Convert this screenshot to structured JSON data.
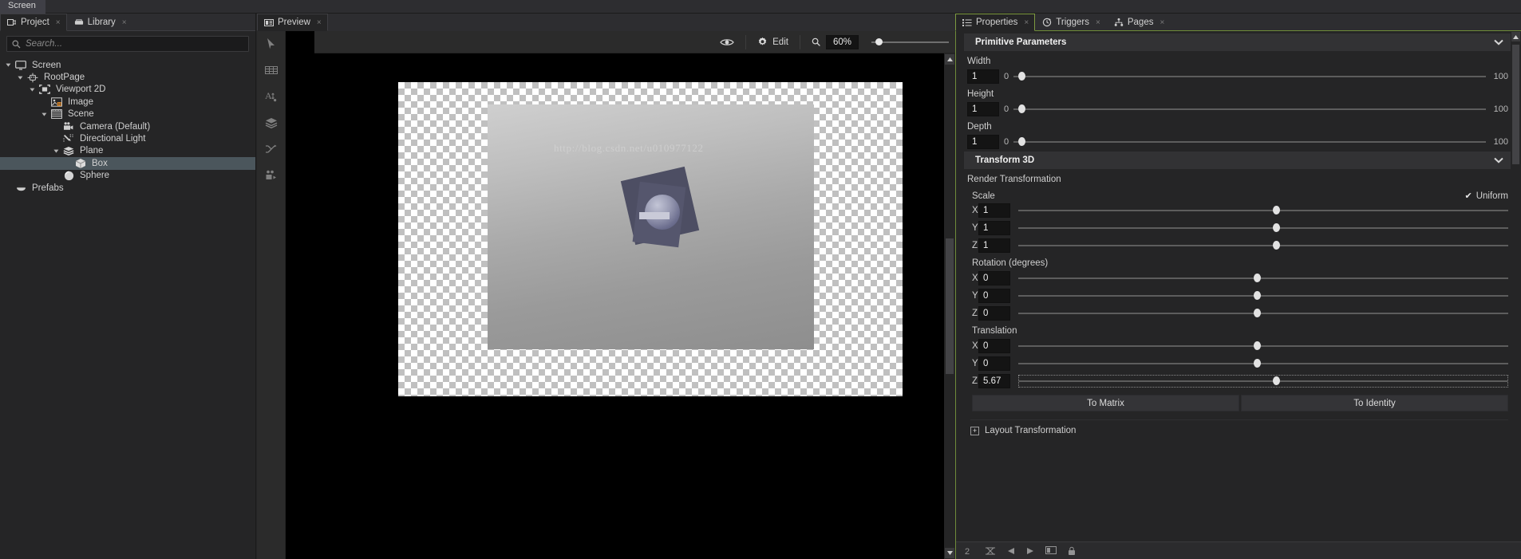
{
  "window": {
    "title": "Screen"
  },
  "left_panel": {
    "tabs": [
      {
        "label": "Project",
        "icon": "project-icon",
        "active": true,
        "close": "×"
      },
      {
        "label": "Library",
        "icon": "library-icon",
        "active": false,
        "close": "×"
      }
    ],
    "search": {
      "placeholder": "Search...",
      "value": "",
      "icon": "search-icon"
    },
    "tree": [
      {
        "label": "Screen",
        "icon": "monitor-icon",
        "depth": 0,
        "arrow": "down",
        "selected": false
      },
      {
        "label": "RootPage",
        "icon": "page-icon",
        "depth": 1,
        "arrow": "down",
        "selected": false
      },
      {
        "label": "Viewport 2D",
        "icon": "viewport-icon",
        "depth": 2,
        "arrow": "down",
        "selected": false
      },
      {
        "label": "Image",
        "icon": "image-icon",
        "depth": 3,
        "arrow": "none",
        "selected": false
      },
      {
        "label": "Scene",
        "icon": "scene-icon",
        "depth": 3,
        "arrow": "down",
        "selected": false
      },
      {
        "label": "Camera (Default)",
        "icon": "camera-icon",
        "depth": 4,
        "arrow": "none",
        "selected": false
      },
      {
        "label": "Directional Light",
        "icon": "light-icon",
        "depth": 4,
        "arrow": "none",
        "selected": false
      },
      {
        "label": "Plane",
        "icon": "plane-icon",
        "depth": 4,
        "arrow": "down",
        "selected": false
      },
      {
        "label": "Box",
        "icon": "box-icon",
        "depth": 5,
        "arrow": "none",
        "selected": true
      },
      {
        "label": "Sphere",
        "icon": "sphere-icon",
        "depth": 4,
        "arrow": "none",
        "selected": false
      },
      {
        "label": "Prefabs",
        "icon": "prefabs-icon",
        "depth": 0,
        "arrow": "none",
        "selected": false
      }
    ]
  },
  "center_panel": {
    "tabs": [
      {
        "label": "Preview",
        "icon": "preview-icon",
        "active": true,
        "close": "×"
      }
    ],
    "toolbar_left": [
      "select-arrow-icon",
      "grid-icon",
      "text-layout-icon",
      "layers-icon",
      "transitions-icon",
      "states-icon"
    ],
    "viewtoolbar": {
      "preview_eye_icon": "eye-icon",
      "edit_label": "Edit",
      "edit_icon": "gear-icon",
      "zoom_icon": "magnifier-icon",
      "zoom_value": "60%"
    },
    "stage": {
      "watermark": "http://blog.csdn.net/u010977122"
    }
  },
  "right_panel": {
    "tabs": [
      {
        "label": "Properties",
        "icon": "properties-icon",
        "active": true,
        "close": "×"
      },
      {
        "label": "Triggers",
        "icon": "triggers-icon",
        "active": false,
        "close": "×"
      },
      {
        "label": "Pages",
        "icon": "pages-icon",
        "active": false,
        "close": "×"
      }
    ],
    "sections": {
      "primitive": {
        "title": "Primitive Parameters",
        "chevron": "chevron-down-icon",
        "fields": [
          {
            "label": "Width",
            "value": "1",
            "min": "0",
            "max": "100",
            "knob_pct": 1
          },
          {
            "label": "Height",
            "value": "1",
            "min": "0",
            "max": "100",
            "knob_pct": 1
          },
          {
            "label": "Depth",
            "value": "1",
            "min": "0",
            "max": "100",
            "knob_pct": 1
          }
        ]
      },
      "transform": {
        "title": "Transform 3D",
        "chevron": "chevron-down-icon",
        "render_transformation_label": "Render Transformation",
        "scale": {
          "label": "Scale",
          "uniform_label": "Uniform",
          "uniform_checked": true,
          "axes": [
            {
              "axis": "X",
              "value": "1",
              "knob_pct": 52
            },
            {
              "axis": "Y",
              "value": "1",
              "knob_pct": 52
            },
            {
              "axis": "Z",
              "value": "1",
              "knob_pct": 52
            }
          ]
        },
        "rotation": {
          "label": "Rotation (degrees)",
          "axes": [
            {
              "axis": "X",
              "value": "0",
              "knob_pct": 48
            },
            {
              "axis": "Y",
              "value": "0",
              "knob_pct": 48
            },
            {
              "axis": "Z",
              "value": "0",
              "knob_pct": 48
            }
          ]
        },
        "translation": {
          "label": "Translation",
          "axes": [
            {
              "axis": "X",
              "value": "0",
              "knob_pct": 48,
              "dotted": false
            },
            {
              "axis": "Y",
              "value": "0",
              "knob_pct": 48,
              "dotted": false
            },
            {
              "axis": "Z",
              "value": "5.67",
              "knob_pct": 52,
              "dotted": true
            }
          ]
        },
        "to_matrix_label": "To Matrix",
        "to_identity_label": "To Identity",
        "layout_transformation_label": "Layout Transformation"
      }
    }
  },
  "colors": {
    "accent_green": "#7d9a41",
    "panel_bg": "#252526",
    "tab_bg": "#2d2d30",
    "selection": "#4b565c",
    "field_bg": "#141414"
  }
}
